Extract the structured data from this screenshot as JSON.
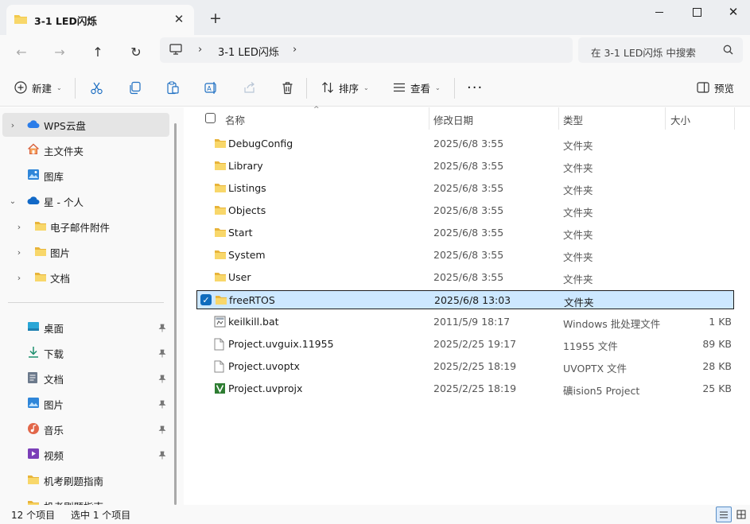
{
  "window": {
    "tab_title": "3-1 LED闪烁",
    "tab_close_icon": "close-icon",
    "new_tab_icon": "plus-icon",
    "controls": [
      "minimize-icon",
      "maximize-icon",
      "close-icon"
    ]
  },
  "nav": {
    "back_icon": "arrow-left-icon",
    "forward_icon": "arrow-right-icon",
    "up_icon": "arrow-up-icon",
    "refresh_icon": "refresh-icon",
    "breadcrumb": [
      "3-1 LED闪烁"
    ],
    "search_placeholder": "在 3-1 LED闪烁 中搜索"
  },
  "commandbar": {
    "new_label": "新建",
    "sort_label": "排序",
    "view_label": "查看",
    "preview_label": "预览",
    "icons": [
      "plus-circle-icon",
      "cut-icon",
      "copy-icon",
      "paste-icon",
      "rename-icon",
      "share-icon",
      "delete-icon",
      "sort-icon",
      "view-icon",
      "more-icon",
      "preview-pane-icon"
    ]
  },
  "sidebar": {
    "items": [
      {
        "label": "WPS云盘",
        "icon": "cloud-icon",
        "expander": "collapsed",
        "active": true
      },
      {
        "label": "主文件夹",
        "icon": "home-icon"
      },
      {
        "label": "图库",
        "icon": "gallery-icon"
      },
      {
        "label": "星 - 个人",
        "icon": "onedrive-icon",
        "expander": "expanded"
      },
      {
        "label": "电子邮件附件",
        "icon": "folder-icon",
        "expander": "collapsed"
      },
      {
        "label": "图片",
        "icon": "folder-icon",
        "expander": "collapsed"
      },
      {
        "label": "文档",
        "icon": "folder-icon",
        "expander": "collapsed"
      }
    ],
    "quick_access": [
      {
        "label": "桌面",
        "icon": "desktop-icon",
        "pinned": true
      },
      {
        "label": "下载",
        "icon": "download-icon",
        "pinned": true
      },
      {
        "label": "文档",
        "icon": "document-icon",
        "pinned": true
      },
      {
        "label": "图片",
        "icon": "pictures-icon",
        "pinned": true
      },
      {
        "label": "音乐",
        "icon": "music-icon",
        "pinned": true
      },
      {
        "label": "视频",
        "icon": "video-icon",
        "pinned": true
      },
      {
        "label": "机考刷题指南",
        "icon": "folder-icon",
        "pinned": false
      },
      {
        "label": "机考刷题指南",
        "icon": "folder-icon",
        "pinned": false
      }
    ]
  },
  "filelist": {
    "columns": {
      "name": "名称",
      "date": "修改日期",
      "type": "类型",
      "size": "大小"
    },
    "rows": [
      {
        "name": "DebugConfig",
        "date": "2025/6/8 3:55",
        "type": "文件夹",
        "size": "",
        "icon": "folder-icon"
      },
      {
        "name": "Library",
        "date": "2025/6/8 3:55",
        "type": "文件夹",
        "size": "",
        "icon": "folder-icon"
      },
      {
        "name": "Listings",
        "date": "2025/6/8 3:55",
        "type": "文件夹",
        "size": "",
        "icon": "folder-icon"
      },
      {
        "name": "Objects",
        "date": "2025/6/8 3:55",
        "type": "文件夹",
        "size": "",
        "icon": "folder-icon"
      },
      {
        "name": "Start",
        "date": "2025/6/8 3:55",
        "type": "文件夹",
        "size": "",
        "icon": "folder-icon"
      },
      {
        "name": "System",
        "date": "2025/6/8 3:55",
        "type": "文件夹",
        "size": "",
        "icon": "folder-icon"
      },
      {
        "name": "User",
        "date": "2025/6/8 3:55",
        "type": "文件夹",
        "size": "",
        "icon": "folder-icon"
      },
      {
        "name": "freeRTOS",
        "date": "2025/6/8 13:03",
        "type": "文件夹",
        "size": "",
        "icon": "folder-icon",
        "selected": true
      },
      {
        "name": "keilkill.bat",
        "date": "2011/5/9 18:17",
        "type": "Windows 批处理文件",
        "size": "1 KB",
        "icon": "batch-file-icon"
      },
      {
        "name": "Project.uvguix.11955",
        "date": "2025/2/25 19:17",
        "type": "11955 文件",
        "size": "89 KB",
        "icon": "file-icon"
      },
      {
        "name": "Project.uvoptx",
        "date": "2025/2/25 18:19",
        "type": "UVOPTX 文件",
        "size": "28 KB",
        "icon": "file-icon"
      },
      {
        "name": "Project.uvprojx",
        "date": "2025/2/25 18:19",
        "type": "礦ision5 Project",
        "size": "25 KB",
        "icon": "keil-project-icon"
      }
    ]
  },
  "status": {
    "item_count": "12 个项目",
    "selection": "选中 1 个项目"
  },
  "colors": {
    "accent": "#0f6cbd",
    "selection_bg": "#cde8ff",
    "folder": "#f2c94c"
  }
}
